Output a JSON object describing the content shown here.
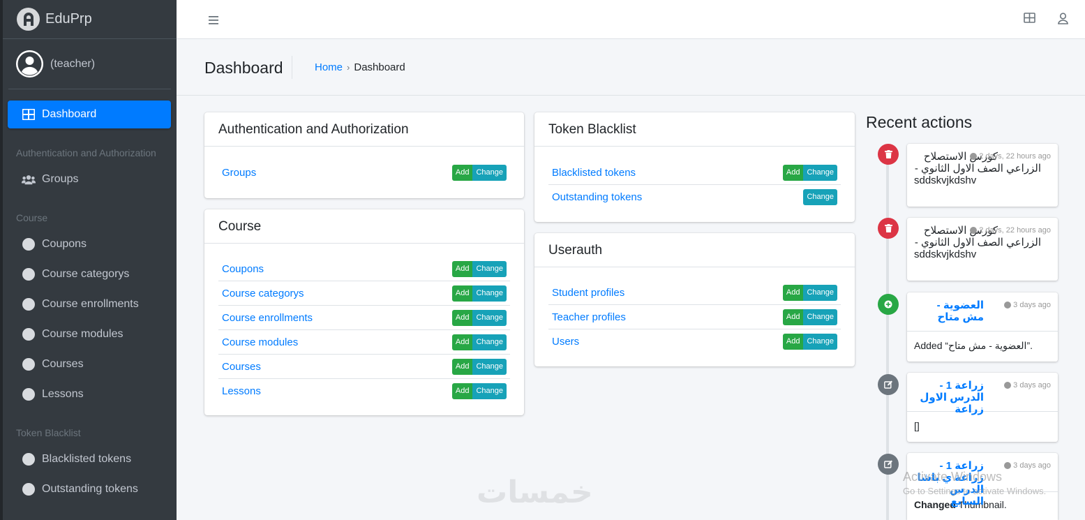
{
  "brand": {
    "name": "EduPrp"
  },
  "user": {
    "name": "(teacher)"
  },
  "sidebar": {
    "dashboard": "Dashboard",
    "sections": [
      {
        "header": "Authentication and Authorization",
        "items": [
          "Groups"
        ]
      },
      {
        "header": "Course",
        "items": [
          "Coupons",
          "Course categorys",
          "Course enrollments",
          "Course modules",
          "Courses",
          "Lessons"
        ]
      },
      {
        "header": "Token Blacklist",
        "items": [
          "Blacklisted tokens",
          "Outstanding tokens"
        ]
      }
    ]
  },
  "header": {
    "title": "Dashboard",
    "breadcrumb": {
      "home": "Home",
      "sep": "›",
      "current": "Dashboard"
    }
  },
  "buttons": {
    "add": "Add",
    "change": "Change"
  },
  "apps": {
    "auth": {
      "title": "Authentication and Authorization",
      "models": [
        "Groups"
      ]
    },
    "course": {
      "title": "Course",
      "models": [
        "Coupons",
        "Course categorys",
        "Course enrollments",
        "Course modules",
        "Courses",
        "Lessons"
      ]
    },
    "token": {
      "title": "Token Blacklist",
      "models": [
        "Blacklisted tokens",
        "Outstanding tokens"
      ]
    },
    "userauth": {
      "title": "Userauth",
      "models": [
        "Student profiles",
        "Teacher profiles",
        "Users"
      ]
    }
  },
  "recent": {
    "title": "Recent actions",
    "items": [
      {
        "time": "2 days, 22 hours ago",
        "title": "كورس الاستصلاح",
        "sub1": "الزراعي الصف الاول الثانوي -",
        "sub2": "sddskvjkdshv"
      },
      {
        "time": "2 days, 22 hours ago",
        "title": "كورس الاستصلاح",
        "sub1": "الزراعي الصف الاول الثانوي -",
        "sub2": "sddskvjkdshv"
      },
      {
        "time": "3 days ago",
        "title": "العضوية - مش متاح",
        "body": "Added “العضوية - مش متاح”."
      },
      {
        "time": "3 days ago",
        "title": "زراعة 1 - الدرس الاول زراعة",
        "body": "[]"
      },
      {
        "time": "3 days ago",
        "title": "زراعة 1 - زراعة ي باشا الدرس السابع",
        "body_bold": "Changed",
        "body_rest": " Thumbnail."
      }
    ]
  },
  "overlay": {
    "activate_title": "Activate Windows",
    "activate_sub": "Go to Settings to activate Windows.",
    "watermark": "خمسات"
  },
  "colors": {
    "primary": "#007bff",
    "success": "#28a745",
    "info": "#17a2b8",
    "danger": "#dc3545",
    "sidebar": "#343a40"
  }
}
